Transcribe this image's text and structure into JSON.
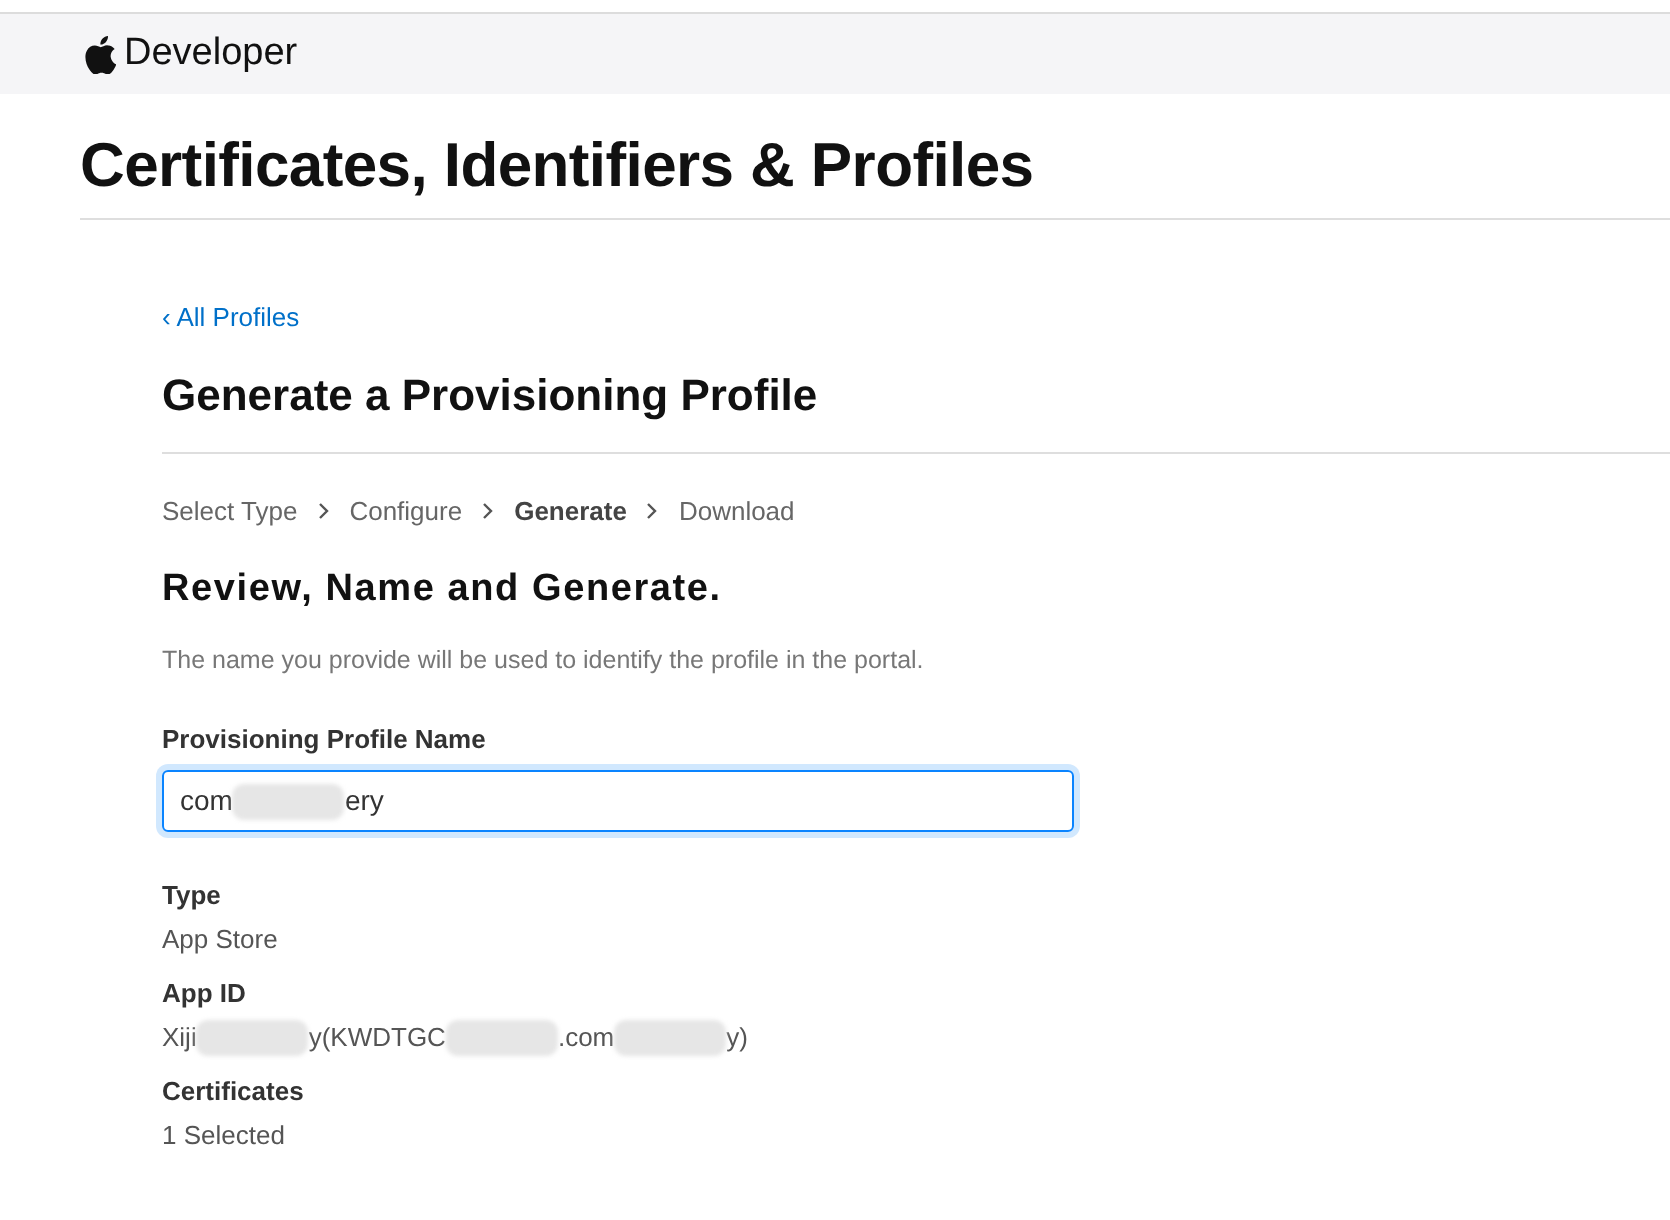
{
  "header": {
    "brand": "Developer"
  },
  "page_title": "Certificates, Identifiers & Profiles",
  "back_link": "‹ All Profiles",
  "heading": "Generate a Provisioning Profile",
  "steps": [
    {
      "label": "Select Type",
      "selected": false
    },
    {
      "label": "Configure",
      "selected": false
    },
    {
      "label": "Generate",
      "selected": true
    },
    {
      "label": "Download",
      "selected": false
    }
  ],
  "section_title": "Review, Name and Generate.",
  "description": "The name you provide will be used to identify the profile in the portal.",
  "name_field": {
    "label": "Provisioning Profile Name",
    "value_parts": [
      "com",
      "ery"
    ]
  },
  "details": [
    {
      "label": "Type",
      "value_parts": [
        "App Store"
      ]
    },
    {
      "label": "App ID",
      "value_parts": [
        "Xiji",
        "y(KWDTGC",
        ".com",
        "y)"
      ]
    },
    {
      "label": "Certificates",
      "value_parts": [
        "1 Selected"
      ]
    }
  ]
}
